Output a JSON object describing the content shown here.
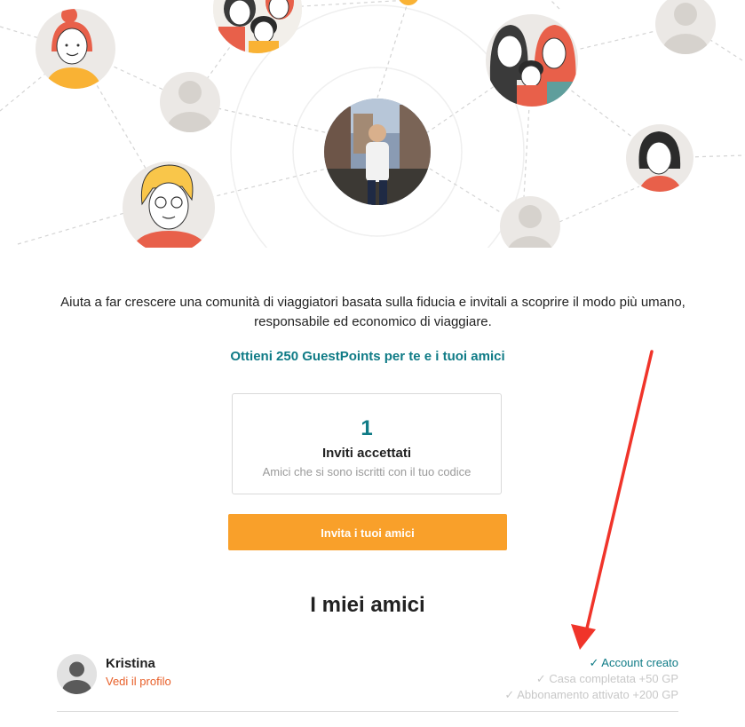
{
  "intro": {
    "text": "Aiuta a far crescere una comunità di viaggiatori basata sulla fiducia e invitali a scoprire il modo più umano, responsabile ed economico di viaggiare."
  },
  "promo": {
    "text": "Ottieni 250 GuestPoints per te e i tuoi amici"
  },
  "stat": {
    "value": "1",
    "label": "Inviti accettati",
    "sublabel": "Amici che si sono iscritti con il tuo codice"
  },
  "invite_button": {
    "label": "Invita i tuoi amici"
  },
  "friends_section": {
    "title": "I miei amici",
    "friends": [
      {
        "name": "Kristina",
        "profile_link": "Vedi il profilo",
        "steps": [
          {
            "label": "Account creato",
            "done": true
          },
          {
            "label": "Casa completata +50 GP",
            "done": false
          },
          {
            "label": "Abbonamento attivato +200 GP",
            "done": false
          }
        ]
      }
    ]
  },
  "colors": {
    "accent_teal": "#0f7b86",
    "button_orange": "#f9a02a",
    "link_orange": "#e8602a",
    "annotation_red": "#f0342a"
  },
  "icons": {
    "check": "✓"
  }
}
